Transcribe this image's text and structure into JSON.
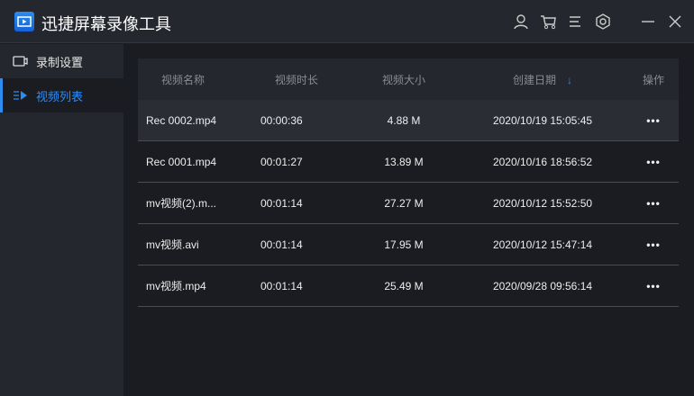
{
  "app": {
    "title": "迅捷屏幕录像工具"
  },
  "sidebar": {
    "items": [
      {
        "label": "录制设置"
      },
      {
        "label": "视频列表"
      }
    ]
  },
  "table": {
    "headers": [
      "视频名称",
      "视频时长",
      "视频大小",
      "创建日期",
      "操作"
    ],
    "rows": [
      {
        "name": "Rec 0002.mp4",
        "duration": "00:00:36",
        "size": "4.88 M",
        "date": "2020/10/19 15:05:45",
        "action": "•••"
      },
      {
        "name": "Rec 0001.mp4",
        "duration": "00:01:27",
        "size": "13.89 M",
        "date": "2020/10/16 18:56:52",
        "action": "•••"
      },
      {
        "name": "mv视频(2).m...",
        "duration": "00:01:14",
        "size": "27.27 M",
        "date": "2020/10/12 15:52:50",
        "action": "•••"
      },
      {
        "name": "mv视频.avi",
        "duration": "00:01:14",
        "size": "17.95 M",
        "date": "2020/10/12 15:47:14",
        "action": "•••"
      },
      {
        "name": "mv视频.mp4",
        "duration": "00:01:14",
        "size": "25.49 M",
        "date": "2020/09/28 09:56:14",
        "action": "•••"
      }
    ]
  },
  "colors": {
    "accent": "#2e8cf0"
  }
}
